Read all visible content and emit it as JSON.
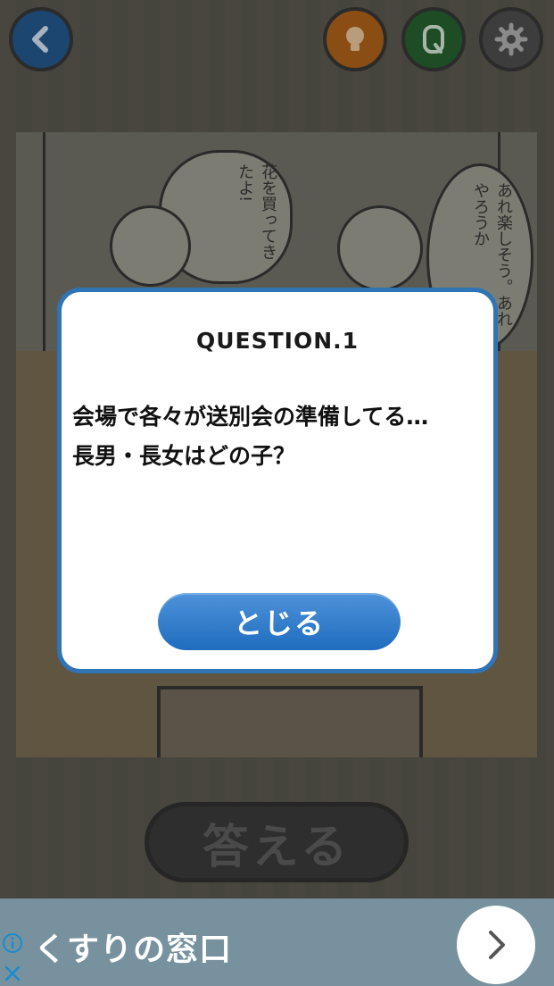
{
  "header": {
    "back_icon": "chevron-left-icon",
    "hint_icon": "lightbulb-icon",
    "question_icon": "q-icon",
    "settings_icon": "gear-icon"
  },
  "comic": {
    "bubble_left": "花を買ってきたよ!",
    "bubble_right": "あれ楽しそう。あれやろうか"
  },
  "modal": {
    "title": "QUESTION.1",
    "line1": "会場で各々が送別会の準備してる…",
    "line2": "長男・長女はどの子？",
    "close_label": "とじる"
  },
  "answer_button": {
    "label": "答える"
  },
  "ad": {
    "text": "くすりの窓口",
    "info_icon": "info-icon",
    "close_icon": "close-icon",
    "arrow_icon": "chevron-right-icon"
  },
  "colors": {
    "modal_border": "#2f74b5",
    "close_button": "#1f6cbe",
    "ad_background": "#77929e"
  }
}
